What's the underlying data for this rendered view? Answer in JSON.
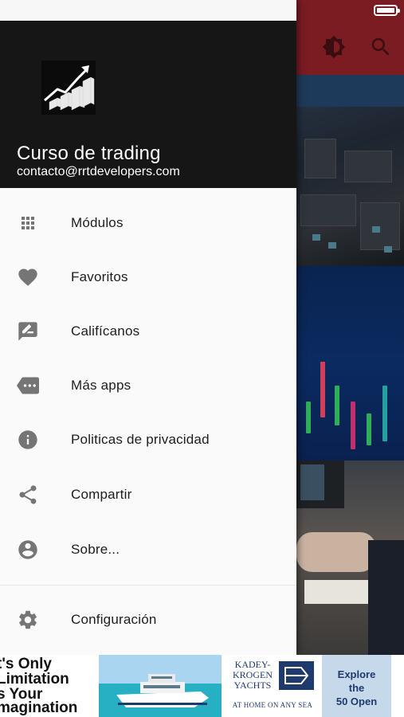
{
  "drawer": {
    "title": "Curso de trading",
    "email": "contacto@rrtdevelopers.com",
    "items": [
      {
        "label": "Módulos",
        "icon": "grid-icon"
      },
      {
        "label": "Favoritos",
        "icon": "heart-icon"
      },
      {
        "label": "Califícanos",
        "icon": "rate-review-icon"
      },
      {
        "label": "Más apps",
        "icon": "more-apps-icon"
      },
      {
        "label": "Politicas de privacidad",
        "icon": "info-icon"
      },
      {
        "label": "Compartir",
        "icon": "share-icon"
      },
      {
        "label": "Sobre...",
        "icon": "account-circle-icon"
      },
      {
        "label": "Configuración",
        "icon": "settings-icon"
      }
    ]
  },
  "ad": {
    "lines": [
      "t's Only",
      "Limitation",
      "s Your",
      "magination"
    ],
    "brand_name": "KADEY-KROGEN YACHTS",
    "tagline": "AT HOME ON ANY SEA",
    "cta": "Explore the 50 Open"
  },
  "colors": {
    "toolbar": "#7a1c22",
    "drawer_header": "#161616",
    "drawer_bg": "#fafafa",
    "icon_grey": "#757575"
  }
}
